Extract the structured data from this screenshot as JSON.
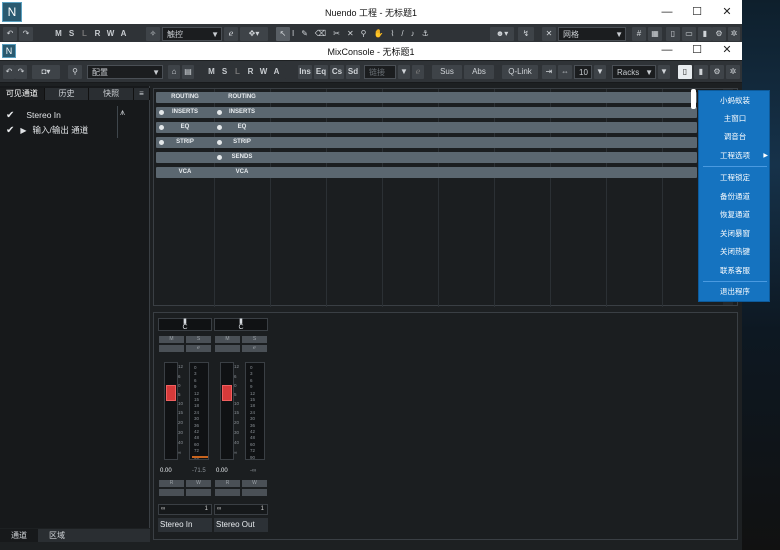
{
  "nuendo": {
    "title": "Nuendo 工程 - 无标题1",
    "touch_mode": "触控",
    "grid": "网格",
    "msl": [
      "M",
      "S",
      "L",
      "R",
      "W",
      "A"
    ]
  },
  "mixconsole": {
    "title": "MixConsole - 无标题1",
    "config": "配置",
    "msl": [
      "M",
      "S",
      "L",
      "R",
      "W",
      "A"
    ],
    "filters": [
      "Ins",
      "Eq",
      "Cs",
      "Sd"
    ],
    "link": "链接",
    "sus": "Sus",
    "abs": "Abs",
    "qlink": "Q-Link",
    "channel_count": "10",
    "racks": "Racks"
  },
  "left_zone": {
    "tabs": [
      "可见通道",
      "历史",
      "快照"
    ],
    "channels": [
      "Stereo In",
      "输入/输出 通道"
    ],
    "bottom_tabs": [
      "通道",
      "区域"
    ]
  },
  "racks": {
    "routing": "ROUTING",
    "inserts": "INSERTS",
    "eq": "EQ",
    "strip": "STRIP",
    "sends": "SENDS",
    "vca": "VCA"
  },
  "strips": [
    {
      "name": "Stereo In",
      "pan": "C",
      "volume": "0.00",
      "peak": "-71.5",
      "link": "1"
    },
    {
      "name": "Stereo Out",
      "pan": "C",
      "volume": "0.00",
      "peak": "-∞",
      "link": "1"
    }
  ],
  "fader_scale": [
    "12",
    "6",
    "0",
    "5",
    "10",
    "15",
    "20",
    "30",
    "40",
    "50",
    "∞"
  ],
  "meter_scale": [
    "0",
    "3",
    "6",
    "9",
    "12",
    "15",
    "18",
    "24",
    "30",
    "36",
    "42",
    "48",
    "60",
    "72",
    "90"
  ],
  "context_menu": [
    "小蚂蚁装",
    "主窗口",
    "调音台",
    "工程选项",
    "工程锁定",
    "备份通道",
    "恢复通道",
    "关闭暴窗",
    "关闭热键",
    "联系客服",
    "退出程序"
  ]
}
